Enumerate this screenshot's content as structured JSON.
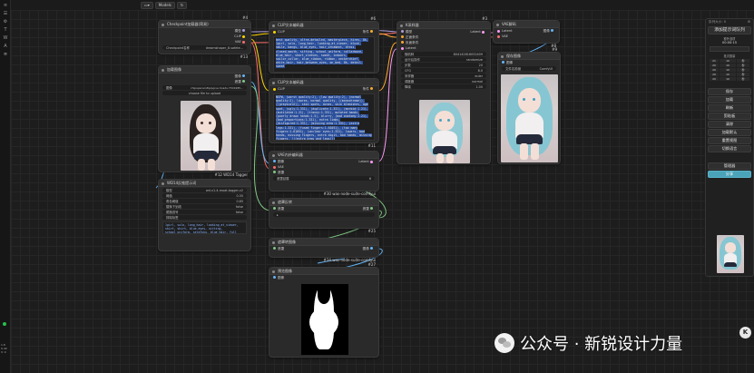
{
  "topbar": {
    "folder_icon": "folder-icon",
    "models_label": "Models",
    "history_icon": "history-icon"
  },
  "leftbar": {
    "icons": [
      "menu-icon",
      "list-icon",
      "settings-icon",
      "text-icon",
      "w-icon",
      "a-icon",
      "queue-icon"
    ]
  },
  "nodes": {
    "checkpoint": {
      "title": "Checkpoint加载器(简易)",
      "badge": "#4",
      "outputs": [
        "模型",
        "CLIP",
        "VAE"
      ],
      "field_label": "Checkpoint名称",
      "field_value": "dreamshaper_8.safete...",
      "foot": "#13"
    },
    "load_image": {
      "title": "加载图像",
      "outputs": [
        "图像",
        "遮罩"
      ],
      "field_label": "图像",
      "field_value": "chipspacers8pqvpve.hoads.7301985...",
      "upload_label": "choose file to upload",
      "foot": "#12 WD14 Tagger"
    },
    "wd14": {
      "title": "WD14反推提示词",
      "fields": [
        {
          "label": "模型",
          "value": "wd-v1-4-moat-tagger-v2"
        },
        {
          "label": "阈值",
          "value": "0.35"
        },
        {
          "label": "角色阈值",
          "value": "0.85"
        },
        {
          "label": "替换下划线",
          "value": "false"
        },
        {
          "label": "尾随逗号",
          "value": "false"
        },
        {
          "label": "排除标签",
          "value": ""
        }
      ],
      "output_text": "1girl, solo, long_hair, looking_at_viewer, skirt, shirt, blue_eyes, sitting, school_uniform, serafuku, blue_hair, full body, indoor"
    },
    "clip_pos": {
      "title": "CLIP文本编码器",
      "badge": "#6",
      "input": "CLIP",
      "output": "条件",
      "text": "best quality, ultra-detailed, masterpiece, hires, 8k, 1girl, solo, long_hair, looking_at_viewer, blush, smile, bangs, blue_eyes, hair_ornament, dress, closed_mouth, sitting, school_uniform, collarbone, blue_hair, short_sleeves, sweat, indoors, sailor_collar, blue_ribbon, ribbon, neckerchief, white_hair, hair_between_eyes, on_bed, 8k, detail, sweat"
    },
    "clip_neg": {
      "title": "CLIP文本编码器",
      "input": "CLIP",
      "output": "条件",
      "text": "NSFW, (worst quality:2), (low quality:2), (normal quality:2), lowres, normal quality, ((monochrome)), ((grayscale)), skin spots, acnes, skin blemishes, age spot, (ugly:1.331), (duplicate:1.331), (morbid:1.21), (mutilated:1.21), (tranny:1.331), mutated hands, (poorly drawn hands:1.5), blurry, (bad anatomy:1.21), (bad proportions:1.331), extra limbs, (disfigured:1.331), (missing arms:1.331), (extra legs:1.331), (fused fingers:1.61051), (too many fingers:1.61051), (unclear eyes:1.331), lowers, bad hands, missing fingers, extra digit, bad hands, missing fingers, (((extra arms and legs)))",
      "foot": "#11"
    },
    "ksampler": {
      "title": "K采样器",
      "badge": "#3",
      "inputs": [
        "模型",
        "正面条件",
        "负面条件",
        "Latent"
      ],
      "output": "Latent",
      "fields": [
        {
          "label": "随机种",
          "value": "804142816052409"
        },
        {
          "label": "运行后操作",
          "value": "randomize"
        },
        {
          "label": "步数",
          "value": "20"
        },
        {
          "label": "CFG",
          "value": "8.0"
        },
        {
          "label": "采样器",
          "value": "euler"
        },
        {
          "label": "调度器",
          "value": "normal"
        },
        {
          "label": "降噪",
          "value": "1.00"
        }
      ]
    },
    "vae_decode": {
      "title": "VAE解码",
      "badge": "#8",
      "inputs": [
        "Latent",
        "VAE"
      ],
      "output": "图像"
    },
    "save_image": {
      "title": "保存图像",
      "badge": "#9",
      "input": "图像",
      "field_label": "文件名前缀",
      "field_value": "ComfyUI"
    },
    "vae_encode": {
      "title": "VAE内补编码器",
      "inputs": [
        "图像",
        "VAE",
        "遮罩"
      ],
      "output": "Latent",
      "field_label": "遮罩延展",
      "field_value": "6",
      "foot": "#30 was-node-suite-comfyui"
    },
    "mask_invert": {
      "title": "遮罩反转",
      "input": "遮罩",
      "output": "遮罩",
      "foot": "#25"
    },
    "mask_to_image": {
      "title": "遮罩转图像",
      "input": "遮罩",
      "output": "图像",
      "foot": "#24 was-node-suite-comfyui"
    },
    "preview_image": {
      "title": "预览图像",
      "input": "图像",
      "foot": "#27"
    }
  },
  "rightpanel": {
    "header_left": "队列大小: 0",
    "header_right": "⚙",
    "queue_button": "添加提示词队列",
    "timer": "00:00:15",
    "extra_label": "额外选项",
    "grid_label": "批次数量",
    "grid": [
      [
        "21",
        "10",
        "秒"
      ],
      [
        "20",
        "10",
        "秒"
      ],
      [
        "20",
        "10",
        "秒"
      ],
      [
        "20",
        "10",
        "秒"
      ],
      [
        "20",
        "10",
        "秒"
      ]
    ],
    "buttons": [
      "保存",
      "加载",
      "刷新",
      "剪贴板",
      "清除",
      "加载默认",
      "重置视图",
      "切换语言"
    ],
    "manager_button": "管理器",
    "share_button": "分享"
  },
  "watermark": {
    "text": "公众号 · 新锐设计力量"
  },
  "corner": {
    "icon_label": "K"
  },
  "bottom_stats": [
    "1.8",
    "0.40",
    "V: 0"
  ],
  "colors": {
    "accent": "#2c55b8",
    "share": "#4aa3b9",
    "wire_clip": "#ffd500",
    "wire_model": "#b39ddb",
    "wire_vae": "#ff6e6e",
    "wire_latent": "#ff9cf9",
    "wire_image": "#64b5f6",
    "wire_cond": "#ffa931",
    "wire_mask": "#81c784"
  }
}
